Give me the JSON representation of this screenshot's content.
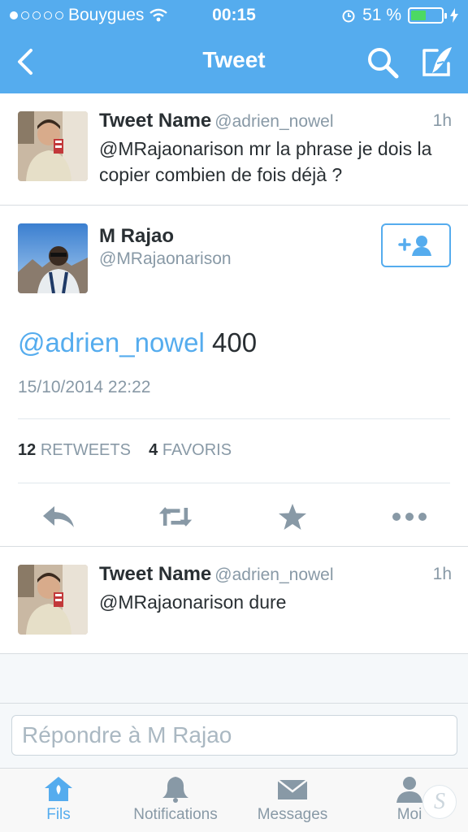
{
  "status_bar": {
    "carrier": "Bouygues",
    "time": "00:15",
    "battery": "51 %",
    "battery_level": 0.51
  },
  "nav": {
    "title": "Tweet",
    "back_icon": "chevron-left-icon",
    "search_icon": "search-icon",
    "compose_icon": "compose-icon"
  },
  "tweets_top": [
    {
      "name": "Tweet Name",
      "handle": "@adrien_nowel",
      "time": "1h",
      "text": "@MRajaonarison mr la phrase je dois la copier combien de fois déjà ?"
    }
  ],
  "main_tweet": {
    "name": "M Rajao",
    "handle": "@MRajaonarison",
    "mention": "@adrien_nowel",
    "text": "400",
    "date": "15/10/2014 22:22",
    "retweets_count": "12",
    "retweets_label": "RETWEETS",
    "favorites_count": "4",
    "favorites_label": "FAVORIS"
  },
  "tweets_bottom": [
    {
      "name": "Tweet Name",
      "handle": "@adrien_nowel",
      "time": "1h",
      "text": "@MRajaonarison dure"
    }
  ],
  "reply": {
    "placeholder": "Répondre à M Rajao"
  },
  "tabs": [
    {
      "label": "Fils",
      "icon": "home-icon",
      "active": true
    },
    {
      "label": "Notifications",
      "icon": "bell-icon",
      "active": false
    },
    {
      "label": "Messages",
      "icon": "envelope-icon",
      "active": false
    },
    {
      "label": "Moi",
      "icon": "person-icon",
      "active": false
    }
  ],
  "colors": {
    "twitter_blue": "#55acee",
    "gray_text": "#8899a6",
    "dark_text": "#292f33"
  }
}
